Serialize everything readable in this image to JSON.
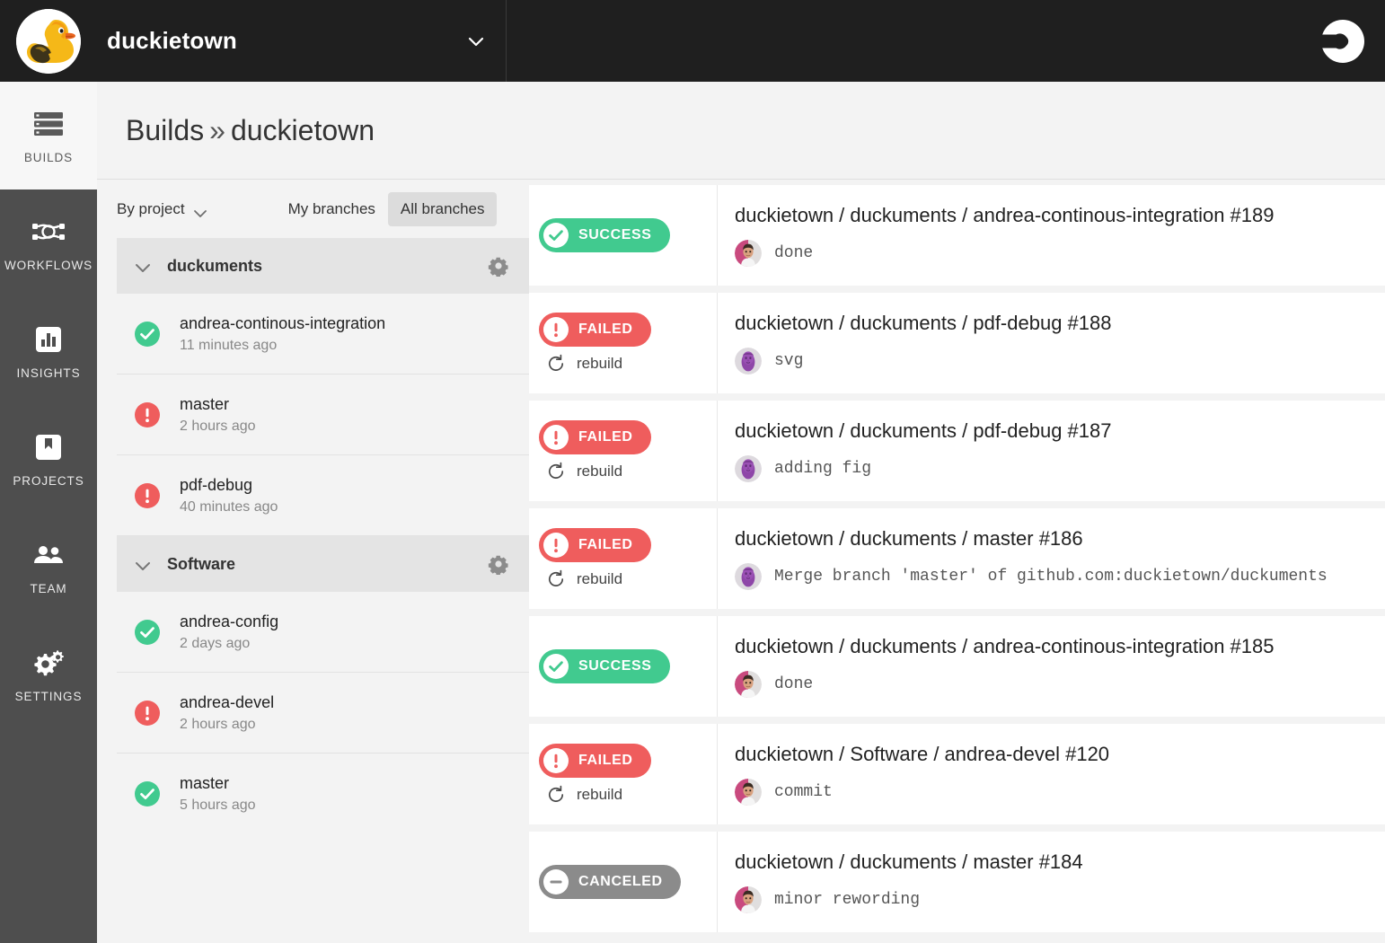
{
  "header": {
    "org_name": "duckietown",
    "org_logo_icon": "duck-logo",
    "org_chevron_icon": "chevron-down-icon",
    "brand_icon": "circleci-logo"
  },
  "sidebar": {
    "items": [
      {
        "label": "BUILDS",
        "icon": "builds-icon",
        "active": true
      },
      {
        "label": "WORKFLOWS",
        "icon": "workflows-icon",
        "active": false
      },
      {
        "label": "INSIGHTS",
        "icon": "insights-icon",
        "active": false
      },
      {
        "label": "PROJECTS",
        "icon": "projects-icon",
        "active": false
      },
      {
        "label": "TEAM",
        "icon": "team-icon",
        "active": false
      },
      {
        "label": "SETTINGS",
        "icon": "settings-icon",
        "active": false
      }
    ]
  },
  "breadcrumb": {
    "root": "Builds",
    "separator": "»",
    "current": "duckietown"
  },
  "filters": {
    "group_by_label": "By project",
    "group_by_chevron_icon": "chevron-down-icon",
    "my_branches_label": "My branches",
    "all_branches_label": "All branches",
    "selected": "All branches"
  },
  "projects": [
    {
      "name": "duckuments",
      "chevron_icon": "chevron-down-icon",
      "gear_icon": "gear-icon",
      "branches": [
        {
          "name": "andrea-continous-integration",
          "time": "11 minutes ago",
          "status": "success"
        },
        {
          "name": "master",
          "time": "2 hours ago",
          "status": "failed"
        },
        {
          "name": "pdf-debug",
          "time": "40 minutes ago",
          "status": "failed"
        }
      ]
    },
    {
      "name": "Software",
      "chevron_icon": "chevron-down-icon",
      "gear_icon": "gear-icon",
      "branches": [
        {
          "name": "andrea-config",
          "time": "2 days ago",
          "status": "success"
        },
        {
          "name": "andrea-devel",
          "time": "2 hours ago",
          "status": "failed"
        },
        {
          "name": "master",
          "time": "5 hours ago",
          "status": "success"
        }
      ]
    }
  ],
  "builds": {
    "rebuild_label": "rebuild",
    "rebuild_icon": "refresh-icon",
    "rows": [
      {
        "status": "success",
        "status_label": "SUCCESS",
        "status_icon": "check-circle-icon",
        "show_rebuild": false,
        "title": "duckietown / duckuments / andrea-continous-integration #189",
        "avatar": "avatar-andrea",
        "commit": "done"
      },
      {
        "status": "failed",
        "status_label": "FAILED",
        "status_icon": "exclamation-circle-icon",
        "show_rebuild": true,
        "title": "duckietown / duckuments / pdf-debug #188",
        "avatar": "avatar-purple",
        "commit": "svg"
      },
      {
        "status": "failed",
        "status_label": "FAILED",
        "status_icon": "exclamation-circle-icon",
        "show_rebuild": true,
        "title": "duckietown / duckuments / pdf-debug #187",
        "avatar": "avatar-purple",
        "commit": "adding fig"
      },
      {
        "status": "failed",
        "status_label": "FAILED",
        "status_icon": "exclamation-circle-icon",
        "show_rebuild": true,
        "title": "duckietown / duckuments / master #186",
        "avatar": "avatar-purple",
        "commit": "Merge branch 'master' of github.com:duckietown/duckuments"
      },
      {
        "status": "success",
        "status_label": "SUCCESS",
        "status_icon": "check-circle-icon",
        "show_rebuild": false,
        "title": "duckietown / duckuments / andrea-continous-integration #185",
        "avatar": "avatar-andrea",
        "commit": "done"
      },
      {
        "status": "failed",
        "status_label": "FAILED",
        "status_icon": "exclamation-circle-icon",
        "show_rebuild": true,
        "title": "duckietown / Software / andrea-devel #120",
        "avatar": "avatar-andrea",
        "commit": "commit"
      },
      {
        "status": "canceled",
        "status_label": "CANCELED",
        "status_icon": "minus-circle-icon",
        "show_rebuild": false,
        "title": "duckietown / duckuments / master #184",
        "avatar": "avatar-andrea",
        "commit": "minor rewording"
      }
    ]
  },
  "colors": {
    "success": "#41ca8f",
    "failed": "#ef5d5d",
    "canceled": "#8b8b8b",
    "topbar_bg": "#1f1f1f",
    "nav_bg": "#4e4e4e",
    "page_bg": "#f3f3f3"
  }
}
